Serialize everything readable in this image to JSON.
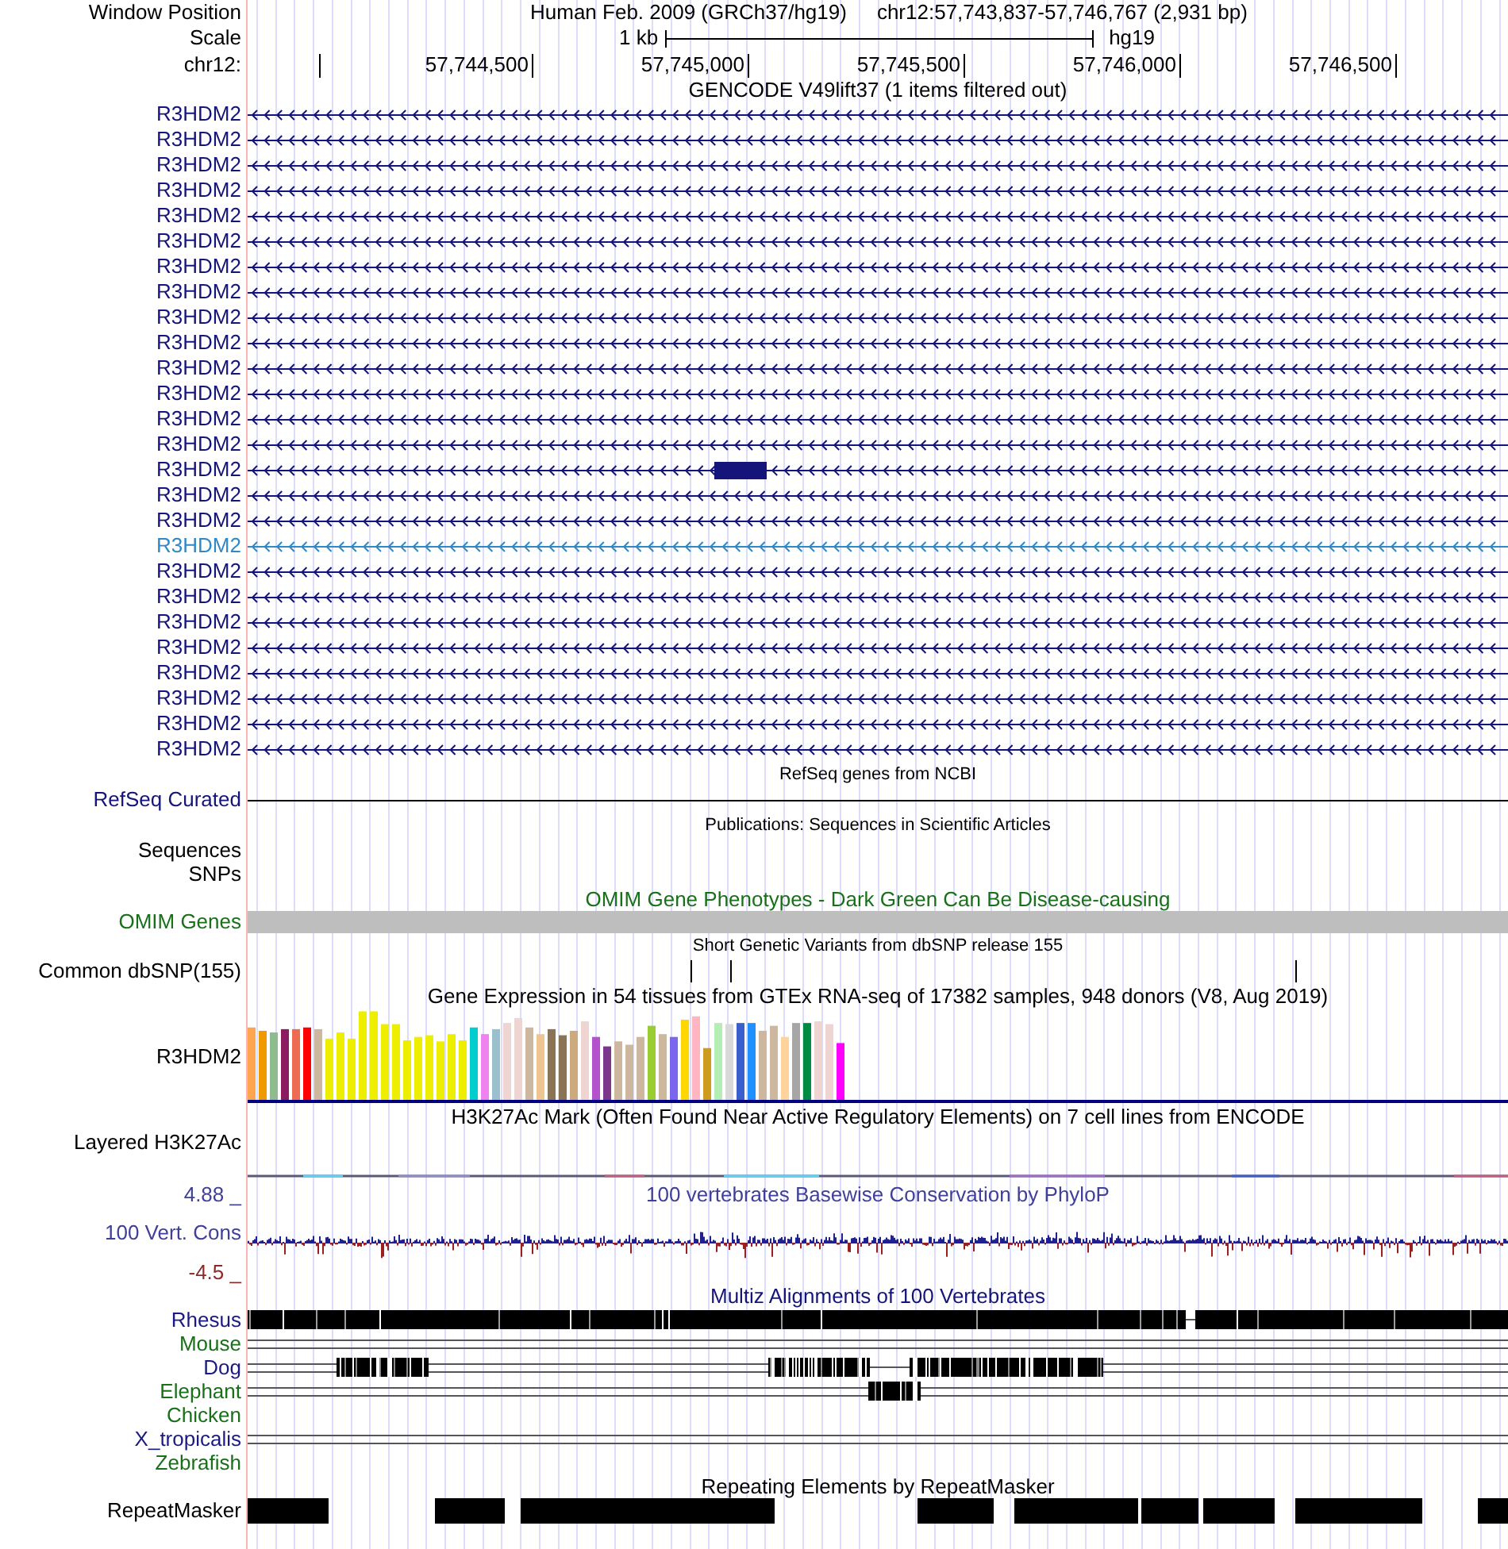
{
  "header": {
    "position_label": "Window Position",
    "assembly": "Human Feb. 2009 (GRCh37/hg19)",
    "position": "chr12:57,743,837-57,746,767 (2,931 bp)",
    "scale_label": "Scale",
    "scale_length": "1 kb",
    "scale_assembly": "hg19",
    "chrom_label": "chr12:",
    "ruler_ticks": [
      "57,744,500",
      "57,745,000",
      "57,745,500",
      "57,746,000",
      "57,746,500"
    ]
  },
  "tracks": [
    {
      "kind": "gencode",
      "title": "GENCODE V49lift37 (1 items filtered out)",
      "items": [
        {
          "label": "R3HDM2",
          "selected": false,
          "exon": false
        },
        {
          "label": "R3HDM2",
          "selected": false,
          "exon": false
        },
        {
          "label": "R3HDM2",
          "selected": false,
          "exon": false
        },
        {
          "label": "R3HDM2",
          "selected": false,
          "exon": false
        },
        {
          "label": "R3HDM2",
          "selected": false,
          "exon": false
        },
        {
          "label": "R3HDM2",
          "selected": false,
          "exon": false
        },
        {
          "label": "R3HDM2",
          "selected": false,
          "exon": false
        },
        {
          "label": "R3HDM2",
          "selected": false,
          "exon": false
        },
        {
          "label": "R3HDM2",
          "selected": false,
          "exon": false
        },
        {
          "label": "R3HDM2",
          "selected": false,
          "exon": false
        },
        {
          "label": "R3HDM2",
          "selected": false,
          "exon": false
        },
        {
          "label": "R3HDM2",
          "selected": false,
          "exon": false
        },
        {
          "label": "R3HDM2",
          "selected": false,
          "exon": false
        },
        {
          "label": "R3HDM2",
          "selected": false,
          "exon": false
        },
        {
          "label": "R3HDM2",
          "selected": false,
          "exon": true
        },
        {
          "label": "R3HDM2",
          "selected": false,
          "exon": false
        },
        {
          "label": "R3HDM2",
          "selected": false,
          "exon": false
        },
        {
          "label": "R3HDM2",
          "selected": true,
          "exon": false
        },
        {
          "label": "R3HDM2",
          "selected": false,
          "exon": false
        },
        {
          "label": "R3HDM2",
          "selected": false,
          "exon": false
        },
        {
          "label": "R3HDM2",
          "selected": false,
          "exon": false
        },
        {
          "label": "R3HDM2",
          "selected": false,
          "exon": false
        },
        {
          "label": "R3HDM2",
          "selected": false,
          "exon": false
        },
        {
          "label": "R3HDM2",
          "selected": false,
          "exon": false
        },
        {
          "label": "R3HDM2",
          "selected": false,
          "exon": false
        },
        {
          "label": "R3HDM2",
          "selected": false,
          "exon": false
        }
      ]
    },
    {
      "kind": "refseq",
      "title": "RefSeq genes from NCBI",
      "label": "RefSeq Curated"
    },
    {
      "kind": "publications",
      "title": "Publications: Sequences in Scientific Articles",
      "labels": [
        "Sequences",
        "SNPs"
      ]
    },
    {
      "kind": "omim",
      "title": "OMIM Gene Phenotypes - Dark Green Can Be Disease-causing",
      "label": "OMIM Genes"
    },
    {
      "kind": "dbsnp",
      "title": "Short Genetic Variants from dbSNP release 155",
      "label": "Common dbSNP(155)"
    },
    {
      "kind": "gtex",
      "title": "Gene Expression in 54 tissues from GTEx RNA-seq of 17382 samples, 948 donors (V8, Aug 2019)",
      "label": "R3HDM2"
    },
    {
      "kind": "h3k27ac",
      "title": "H3K27Ac Mark (Often Found Near Active Regulatory Elements) on 7 cell lines from ENCODE",
      "label": "Layered H3K27Ac"
    },
    {
      "kind": "phylop",
      "title": "100 vertebrates Basewise Conservation by PhyloP",
      "label": "100 Vert. Cons",
      "max_label": "4.88 _",
      "min_label": "-4.5 _"
    },
    {
      "kind": "multiz",
      "title": "Multiz Alignments of 100 Vertebrates",
      "species": [
        {
          "name": "Rhesus",
          "color": "#1a1a80"
        },
        {
          "name": "Mouse",
          "color": "#187018"
        },
        {
          "name": "Dog",
          "color": "#1a1a80"
        },
        {
          "name": "Elephant",
          "color": "#187018"
        },
        {
          "name": "Chicken",
          "color": "#187018"
        },
        {
          "name": "X_tropicalis",
          "color": "#1a1a80"
        },
        {
          "name": "Zebrafish",
          "color": "#187018"
        }
      ]
    },
    {
      "kind": "repeatmasker",
      "title": "Repeating Elements by RepeatMasker",
      "label": "RepeatMasker"
    }
  ]
}
